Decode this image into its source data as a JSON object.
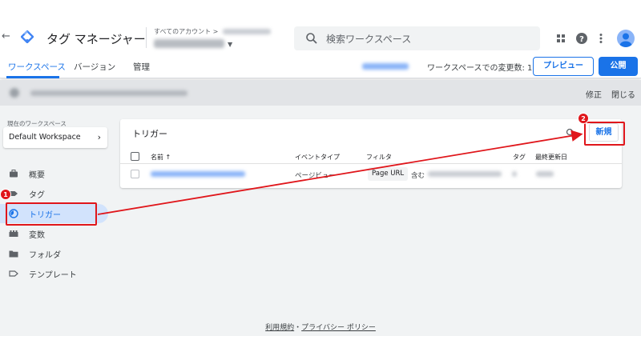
{
  "header": {
    "product_name": "タグ マネージャー",
    "account_label": "すべてのアカウント",
    "account_sep": ">",
    "search_placeholder": "検索ワークスペース"
  },
  "tabs": [
    {
      "label": "ワークスペース",
      "active": true
    },
    {
      "label": "バージョン",
      "active": false
    },
    {
      "label": "管理",
      "active": false
    }
  ],
  "workspace_bar": {
    "changes_label": "ワークスペースでの変更数: 1",
    "preview_label": "プレビュー",
    "publish_label": "公開"
  },
  "notice": {
    "fix_label": "修正",
    "close_label": "閉じる"
  },
  "sidebar": {
    "current_ws_label": "現在のワークスペース",
    "workspace_name": "Default Workspace",
    "items": [
      {
        "label": "概要",
        "icon": "briefcase-icon"
      },
      {
        "label": "タグ",
        "icon": "tag-icon"
      },
      {
        "label": "トリガー",
        "icon": "trigger-icon",
        "active": true
      },
      {
        "label": "変数",
        "icon": "variables-icon"
      },
      {
        "label": "フォルダ",
        "icon": "folder-icon"
      },
      {
        "label": "テンプレート",
        "icon": "template-icon"
      }
    ]
  },
  "triggers": {
    "title": "トリガー",
    "new_label": "新規",
    "columns": {
      "name": "名前 ↑",
      "event_type": "イベントタイプ",
      "filter": "フィルタ",
      "tag": "タグ",
      "last_edited": "最終更新日"
    },
    "rows": [
      {
        "event_type": "ページビュー",
        "filter_var": "Page URL",
        "filter_op": "含む"
      }
    ]
  },
  "footer": {
    "terms": "利用規約",
    "sep": "・",
    "privacy": "プライバシー ポリシー"
  },
  "annotations": [
    {
      "number": "1"
    },
    {
      "number": "2"
    }
  ],
  "colors": {
    "accent": "#1a73e8",
    "annotation": "#e0161b"
  }
}
